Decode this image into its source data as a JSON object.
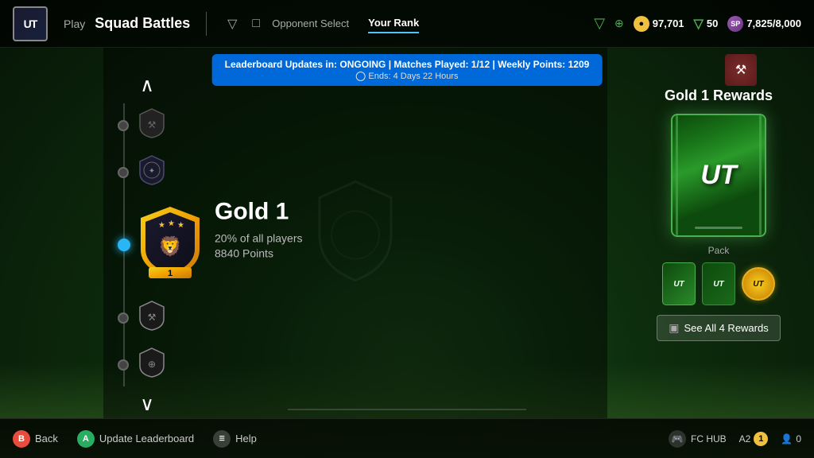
{
  "app": {
    "logo": "UT",
    "nav": {
      "play_label": "Play",
      "title": "Squad Battles",
      "tab_opponent": "Opponent Select",
      "tab_rank": "Your Rank",
      "active_tab": "opponent"
    },
    "currencies": {
      "coins": "97,701",
      "shield": "50",
      "fc_points": "7,825/8,000"
    },
    "icons": {
      "filter": "▽",
      "fc": "FC",
      "coin": "C"
    }
  },
  "banner": {
    "main": "Leaderboard Updates in: ONGOING  |  Matches Played: 1/12  |  Weekly Points: 1209",
    "sub": "Ends: 4 Days 22 Hours"
  },
  "rank_selector": {
    "arrow_up": "∧",
    "arrow_down": "∨",
    "current_rank": {
      "name": "Gold 1",
      "percent": "20% of all players",
      "points": "8840 Points"
    }
  },
  "rewards": {
    "title": "Gold 1 Rewards",
    "pack_label": "Pack",
    "see_all_label": "See All 4 Rewards",
    "pack_text": "UT",
    "pack_small_1": "UT",
    "pack_small_2": "UT",
    "pack_coin_text": "UT"
  },
  "bottom": {
    "back_label": "Back",
    "update_label": "Update Leaderboard",
    "help_label": "Help",
    "fc_hub_label": "FC HUB",
    "rank_num": "1",
    "player_count": "0"
  }
}
